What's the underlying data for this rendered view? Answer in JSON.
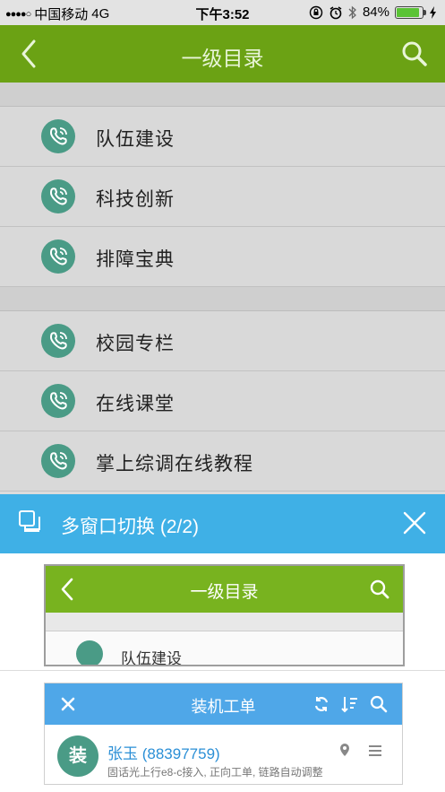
{
  "status_bar": {
    "carrier": "中国移动",
    "network": "4G",
    "time": "下午3:52",
    "battery_percent": "84%",
    "battery_level": 0.84
  },
  "header": {
    "title": "一级目录",
    "accent_color": "#6ba214"
  },
  "groups": [
    {
      "items": [
        {
          "label": "队伍建设",
          "icon": "phone-icon"
        },
        {
          "label": "科技创新",
          "icon": "phone-icon"
        },
        {
          "label": "排障宝典",
          "icon": "phone-icon"
        }
      ]
    },
    {
      "items": [
        {
          "label": "校园专栏",
          "icon": "phone-icon"
        },
        {
          "label": "在线课堂",
          "icon": "phone-icon"
        },
        {
          "label": "掌上综调在线教程",
          "icon": "phone-icon"
        }
      ]
    }
  ],
  "switcher": {
    "title": "多窗口切换 (2/2)",
    "bar_color": "#3fb0e6",
    "window1": {
      "title": "一级目录",
      "first_item": "队伍建设"
    },
    "window2": {
      "title": "装机工单",
      "avatar_text": "装",
      "contact_name": "张玉 (88397759)",
      "description": "固话光上行e8-c接入, 正向工单, 链路自动调整"
    }
  }
}
